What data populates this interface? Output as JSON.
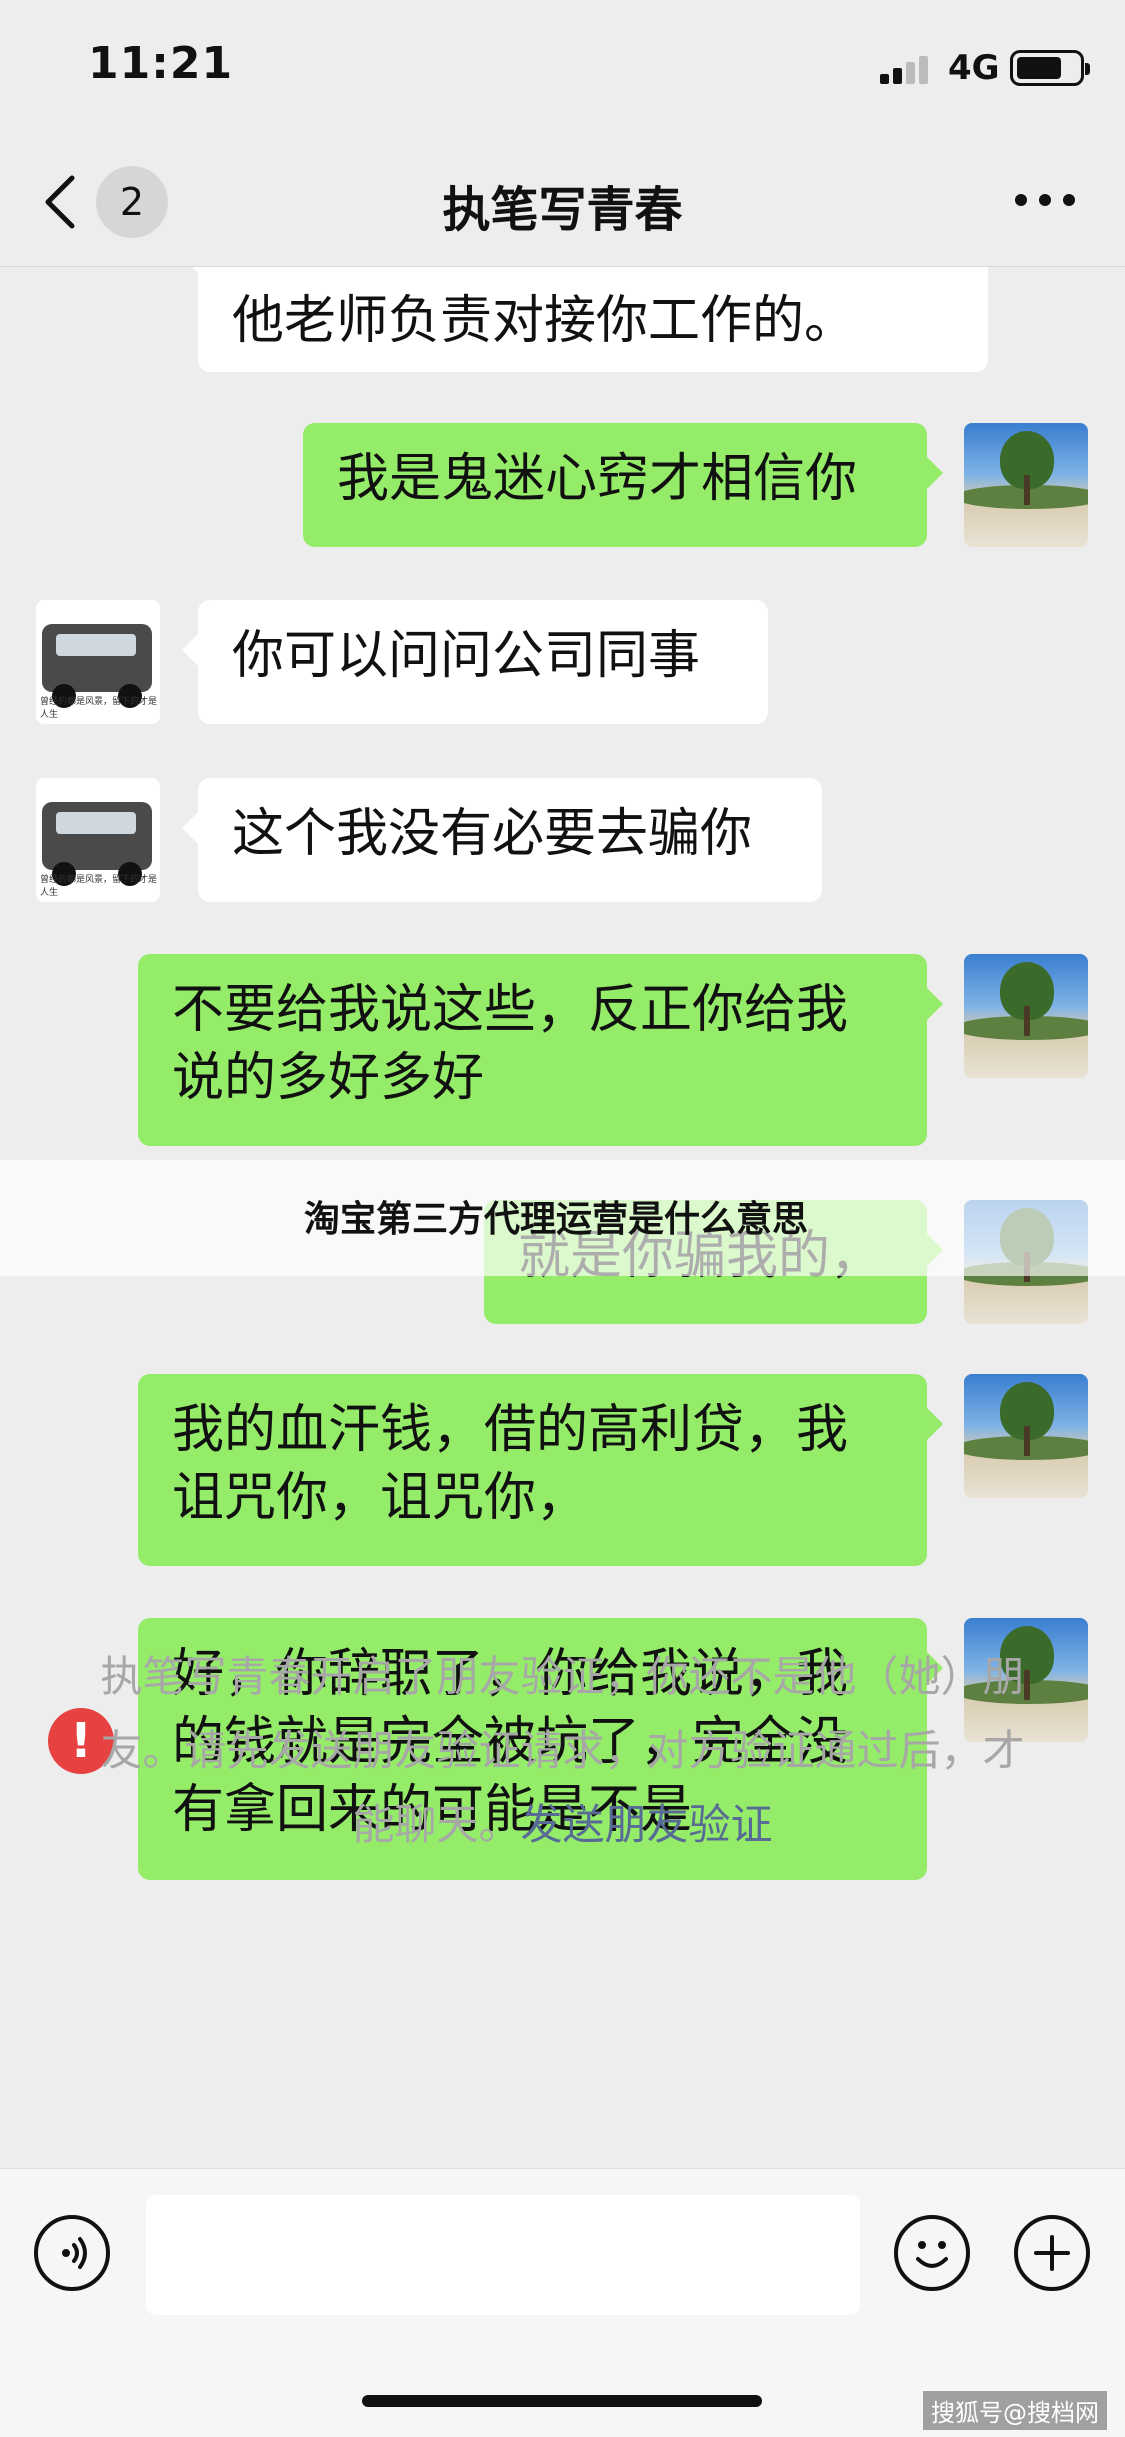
{
  "status_bar": {
    "time": "11:21",
    "network": "4G"
  },
  "nav": {
    "unread_count": "2",
    "title": "执笔写青春"
  },
  "messages": [
    {
      "side": "left",
      "text": "他老师负责对接你工作的。"
    },
    {
      "side": "right",
      "text": "我是鬼迷心窍才相信你"
    },
    {
      "side": "left",
      "text": "你可以问问公司同事"
    },
    {
      "side": "left",
      "text": "这个我没有必要去骗你"
    },
    {
      "side": "right",
      "text": "不要给我说这些，反正你给我说的多好多好"
    },
    {
      "side": "right",
      "text": "就是你骗我的，"
    },
    {
      "side": "right",
      "text": "我的血汗钱，借的高利贷，我诅咒你，诅咒你，"
    },
    {
      "side": "right",
      "text": "好，你辞职了，你给我说，我的钱就是完全被坑了，完全没有拿回来的可能是不是",
      "status": "failed"
    }
  ],
  "contact_avatar_caption": "曾经的都是风景，留下的才是人生",
  "system_notice": {
    "text": "执笔写青春开启了朋友验证，你还不是他（她）朋友。请先发送朋友验证请求，对方验证通过后，才能聊天。",
    "link": "发送朋友验证"
  },
  "overlay_caption": "淘宝第三方代理运营是什么意思",
  "watermark": "搜狐号@搜档网",
  "icons": {
    "back": "chevron-left-icon",
    "more": "more-dots-icon",
    "voice": "voice-icon",
    "emoji": "emoji-icon",
    "add": "plus-icon",
    "error": "error-icon"
  },
  "colors": {
    "self_bubble": "#95ec69",
    "other_bubble": "#ffffff",
    "link": "#576b95",
    "error": "#e84141"
  }
}
